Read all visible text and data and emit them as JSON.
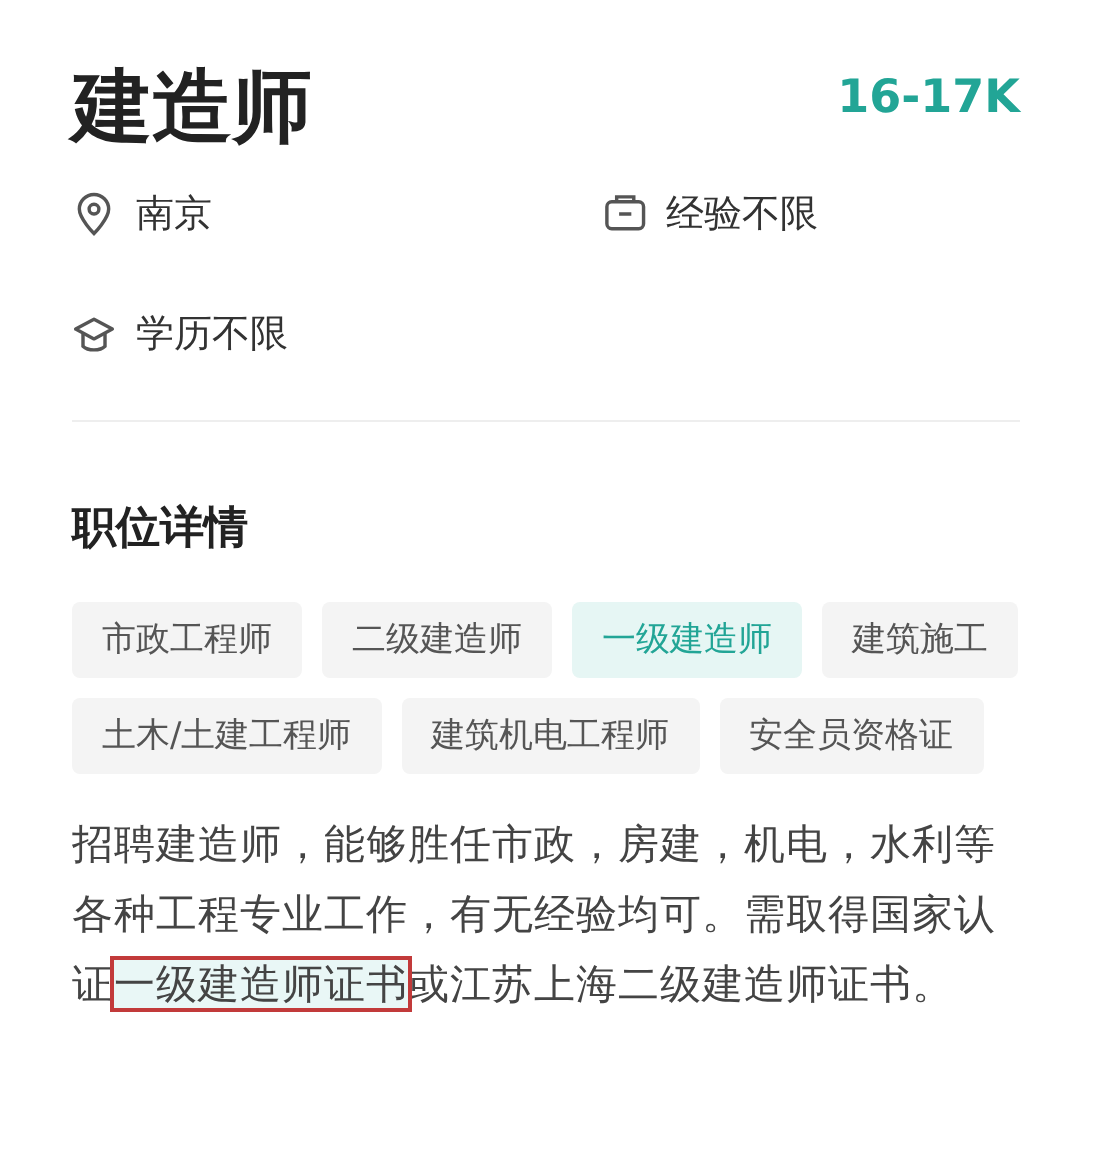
{
  "job": {
    "title": "建造师",
    "salary": "16-17K"
  },
  "meta": [
    {
      "kind": "location",
      "text": "南京"
    },
    {
      "kind": "experience",
      "text": "经验不限"
    },
    {
      "kind": "education",
      "text": "学历不限"
    }
  ],
  "section": {
    "heading": "职位详情"
  },
  "tags": [
    {
      "label": "市政工程师",
      "selected": false
    },
    {
      "label": "二级建造师",
      "selected": false
    },
    {
      "label": "一级建造师",
      "selected": true
    },
    {
      "label": "建筑施工",
      "selected": false
    },
    {
      "label": "土木/土建工程师",
      "selected": false
    },
    {
      "label": "建筑机电工程师",
      "selected": false
    },
    {
      "label": "安全员资格证",
      "selected": false
    }
  ],
  "description": {
    "before": "招聘建造师，能够胜任市政，房建，机电，水利等各种工程专业工作，有无经验均可。需取得国家认证",
    "highlight": "一级建造师证书",
    "after": "或江苏上海二级建造师证书。"
  }
}
